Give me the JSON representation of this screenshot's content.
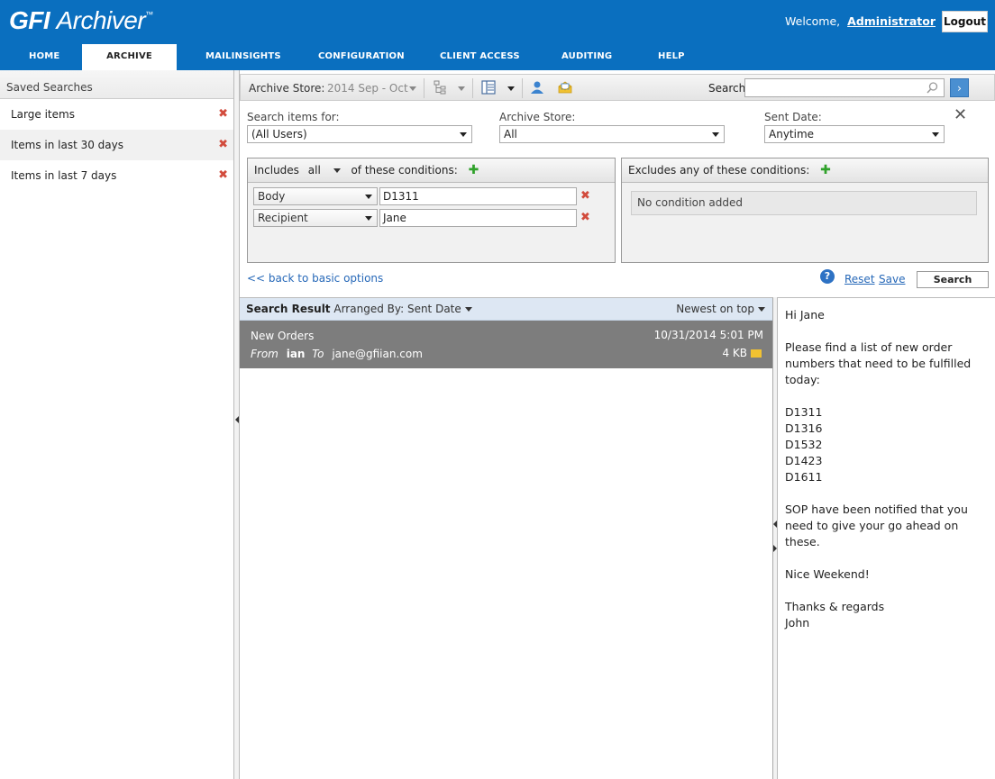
{
  "header": {
    "logo_bold": "GFI",
    "logo_text": "Archiver",
    "logo_tm": "™",
    "welcome": "Welcome,",
    "user": "Administrator",
    "logout": "Logout"
  },
  "nav": {
    "home": "Home",
    "archive": "Archive",
    "mailinsights": "MailInsights",
    "configuration": "Configuration",
    "client_access": "Client Access",
    "auditing": "Auditing",
    "help": "Help"
  },
  "sidebar": {
    "title": "Saved Searches",
    "items": [
      {
        "label": "Large items"
      },
      {
        "label": "Items in last 30 days"
      },
      {
        "label": "Items in last 7 days"
      }
    ],
    "delete_glyph": "✖"
  },
  "toolbar": {
    "archive_store_label": "Archive Store:",
    "archive_store_value": "2014 Sep - Oct",
    "search_label": "Search:",
    "search_value": "",
    "go_glyph": "›"
  },
  "form": {
    "search_items_label": "Search items for:",
    "search_items_value": "(All Users)",
    "archive_store_label": "Archive Store:",
    "archive_store_value": "All",
    "sent_date_label": "Sent Date:",
    "sent_date_value": "Anytime",
    "close_glyph": "✕"
  },
  "includes": {
    "prefix": "Includes",
    "mode": "all",
    "suffix": "of these conditions:",
    "plus": "✚",
    "conditions": [
      {
        "field": "Body",
        "value": "D1311"
      },
      {
        "field": "Recipient",
        "value": "Jane"
      }
    ]
  },
  "excludes": {
    "title": "Excludes any of these conditions:",
    "plus": "✚",
    "empty": "No condition added"
  },
  "actions": {
    "back": "<< back to basic options",
    "help": "?",
    "reset": "Reset",
    "save": "Save",
    "search": "Search"
  },
  "results": {
    "title": "Search Result",
    "arranged": "Arranged By: Sent Date",
    "sort": "Newest on top",
    "messages": [
      {
        "subject": "New Orders",
        "from_label": "From",
        "from": "ian",
        "to_label": "To",
        "to": "jane@gfiian.com",
        "date": "10/31/2014 5:01 PM",
        "size": "4 KB"
      }
    ]
  },
  "preview": {
    "greeting": "Hi Jane",
    "intro": "Please find a list of new order numbers that need to be fulfilled today:",
    "orders": [
      "D1311",
      "D1316",
      "D1532",
      "D1423",
      "D1611"
    ],
    "note": "SOP have been notified that you need to give your go ahead on these.",
    "wish": "Nice Weekend!",
    "closing": "Thanks & regards",
    "signature": "John"
  },
  "colors": {
    "brand_blue": "#0a6fbf",
    "delete_red": "#d24b3c",
    "add_green": "#2fa12a",
    "link_blue": "#2668b8"
  }
}
